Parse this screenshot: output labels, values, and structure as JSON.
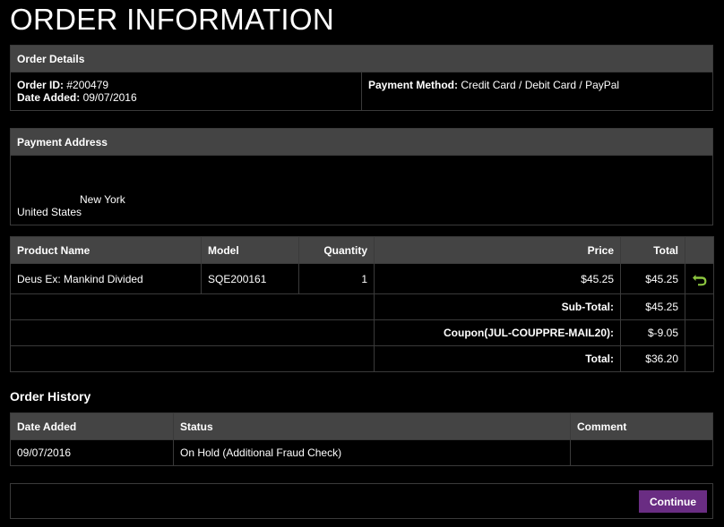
{
  "page_title": "ORDER INFORMATION",
  "order_details": {
    "header": "Order Details",
    "order_id_label": "Order ID:",
    "order_id": "#200479",
    "date_added_label": "Date Added:",
    "date_added": "09/07/2016",
    "payment_method_label": "Payment Method:",
    "payment_method": "Credit Card / Debit Card / PayPal"
  },
  "payment_address": {
    "header": "Payment Address",
    "city": "New York",
    "country": "United States"
  },
  "products": {
    "columns": {
      "name": "Product Name",
      "model": "Model",
      "quantity": "Quantity",
      "price": "Price",
      "total": "Total"
    },
    "rows": [
      {
        "name": "Deus Ex: Mankind Divided",
        "model": "SQE200161",
        "quantity": "1",
        "price": "$45.25",
        "total": "$45.25",
        "action_icon": "return-icon"
      }
    ],
    "totals": [
      {
        "label": "Sub-Total:",
        "value": "$45.25"
      },
      {
        "label": "Coupon(JUL-COUPPRE-MAIL20):",
        "value": "$-9.05"
      },
      {
        "label": "Total:",
        "value": "$36.20"
      }
    ]
  },
  "order_history": {
    "title": "Order History",
    "columns": {
      "date_added": "Date Added",
      "status": "Status",
      "comment": "Comment"
    },
    "rows": [
      {
        "date_added": "09/07/2016",
        "status": "On Hold (Additional Fraud Check)",
        "comment": ""
      }
    ]
  },
  "continue_label": "Continue",
  "colors": {
    "background": "#000000",
    "header_bg": "#444444",
    "border": "#3a3a3a",
    "accent": "#6a2d83",
    "return_icon": "#8cc63f"
  }
}
